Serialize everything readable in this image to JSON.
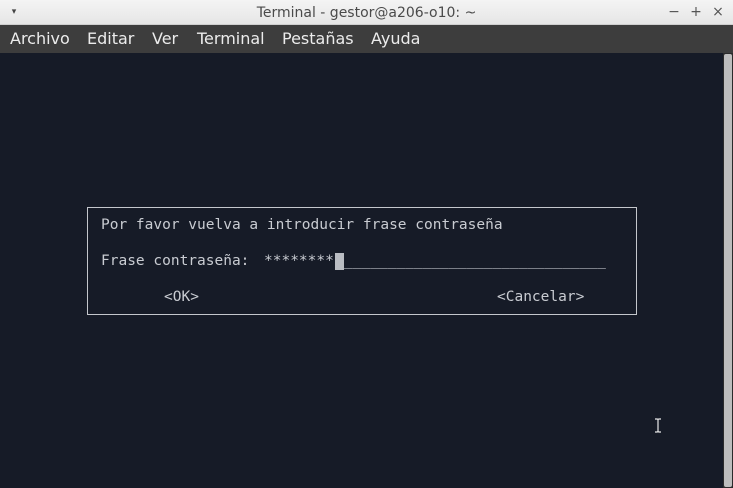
{
  "window": {
    "title": "Terminal - gestor@a206-o10: ~",
    "controls": {
      "menu": "▾",
      "minimize": "−",
      "maximize": "+",
      "close": "×"
    }
  },
  "menubar": {
    "items": [
      "Archivo",
      "Editar",
      "Ver",
      "Terminal",
      "Pestañas",
      "Ayuda"
    ]
  },
  "dialog": {
    "prompt": "Por favor vuelva a introducir frase contraseña",
    "field_label": "Frase contraseña:",
    "field_value": "********",
    "field_blank": "______________________________",
    "ok_label": "<OK>",
    "cancel_label": "<Cancelar>"
  },
  "colors": {
    "terminal_bg": "#161b27",
    "terminal_fg": "#c9ccd2",
    "menubar_bg": "#3d3d3d"
  }
}
